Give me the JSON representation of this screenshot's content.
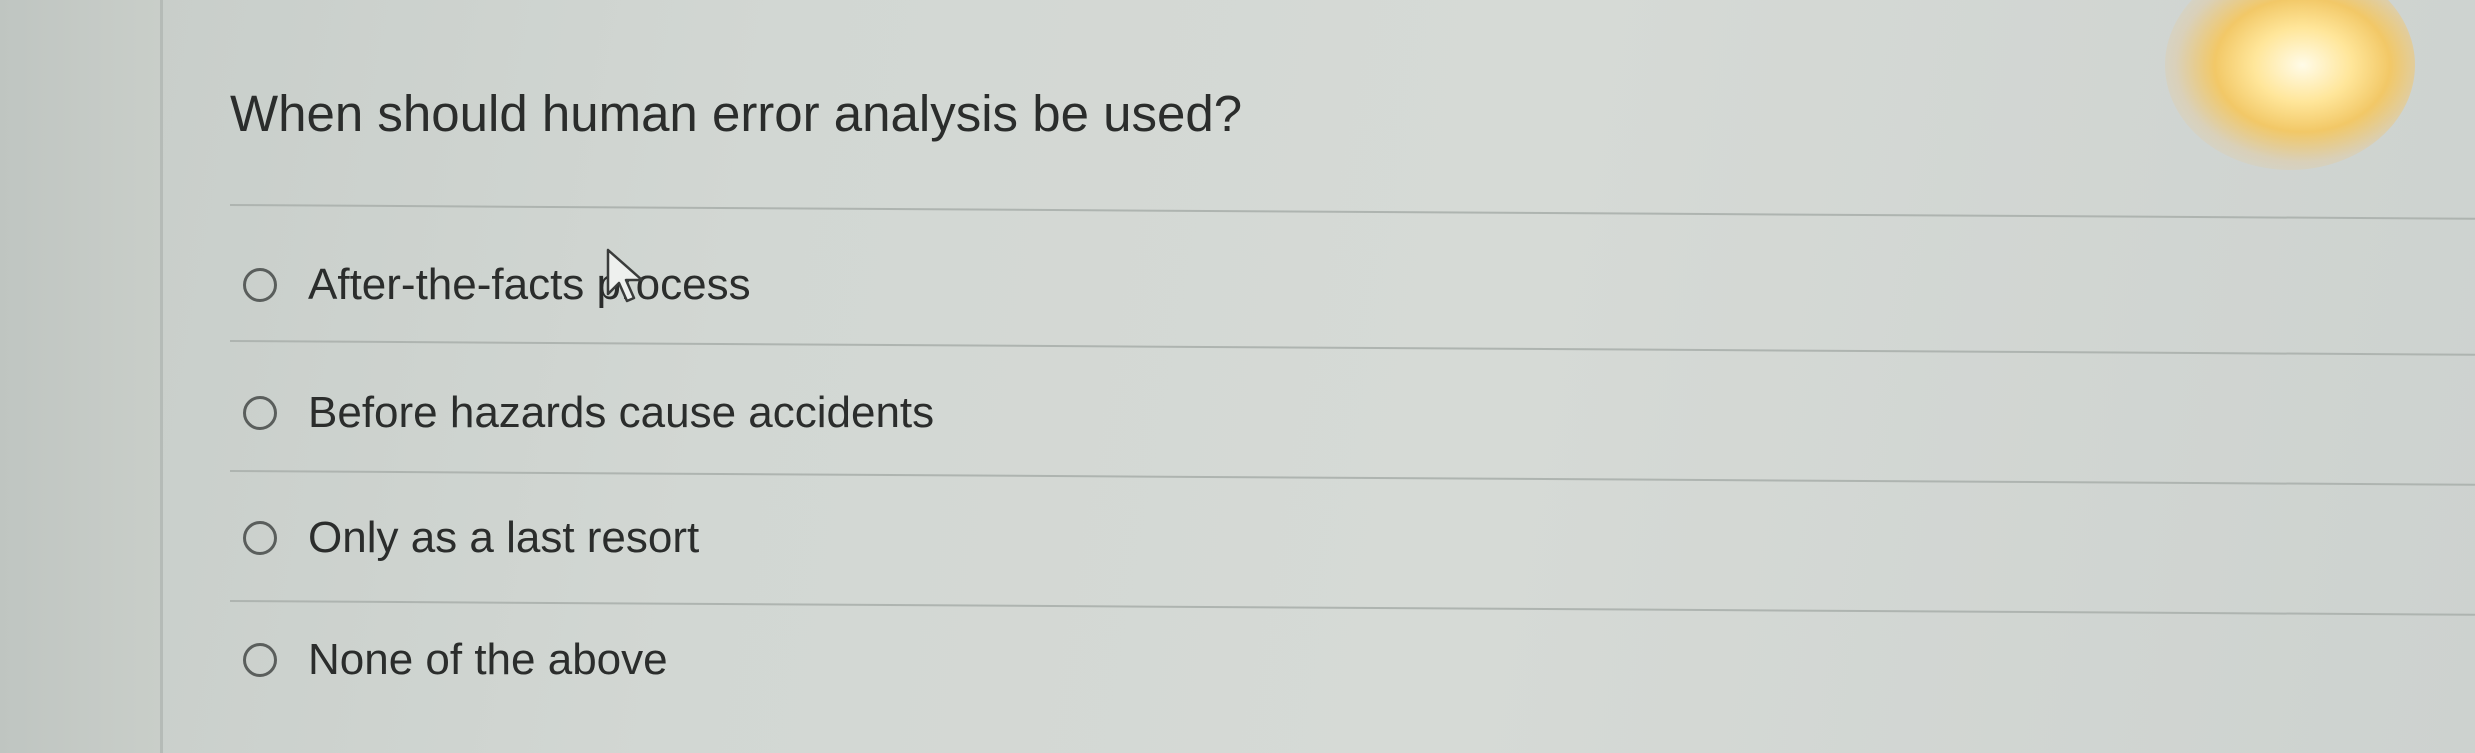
{
  "quiz": {
    "question": "When should human error analysis be used?",
    "options": [
      {
        "label": "After-the-facts process",
        "selected": false
      },
      {
        "label": "Before hazards cause accidents",
        "selected": false
      },
      {
        "label": "Only as a last resort",
        "selected": false
      },
      {
        "label": "None of the above",
        "selected": false
      }
    ]
  },
  "icons": {
    "radio": "radio-unselected-icon",
    "pointer": "mouse-pointer-icon"
  },
  "colors": {
    "text": "#2b2d2c",
    "radio_border": "#5a5e5c",
    "divider": "#aeb4b0"
  }
}
